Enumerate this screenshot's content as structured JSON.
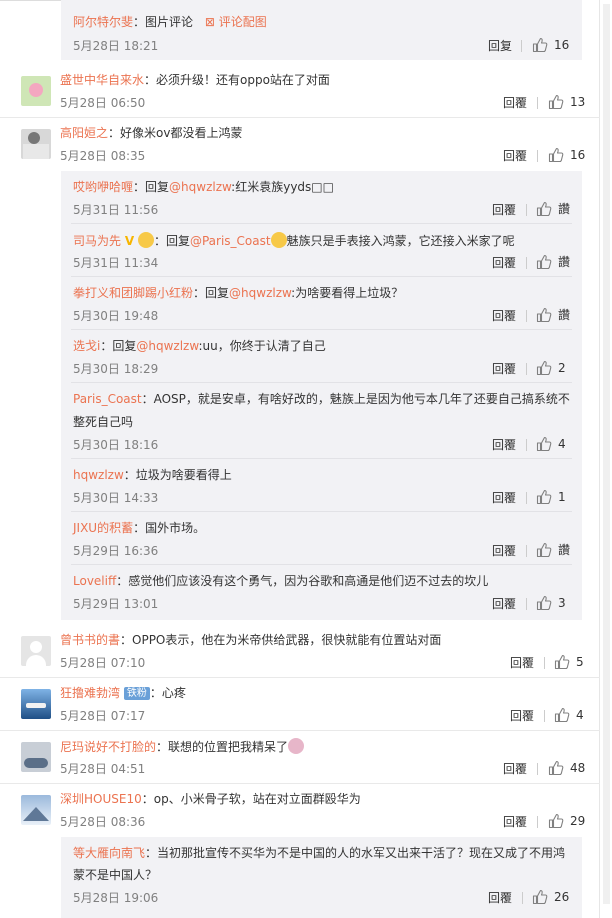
{
  "ui": {
    "reply_label": "回复",
    "reply_label_alt": "回覆",
    "sub_reply_label": "回覆"
  },
  "top": {
    "user": "阿尔特尔斐",
    "text": "：图片评论",
    "pic_link": "评论配图",
    "time": "5月28日 18:21",
    "likes": "16"
  },
  "comments": [
    {
      "user": "盛世中华自来水",
      "text": "：必须升级！还有oppo站在了对面",
      "time": "5月28日 06:50",
      "reply": "回覆",
      "likes": "13"
    },
    {
      "user": "高阳姮之",
      "text": "：好像米ov都没看上鸿蒙",
      "time": "5月28日 08:35",
      "reply": "回覆",
      "likes": "16"
    }
  ],
  "replies": [
    {
      "user": "哎哟咿哈喱",
      "pre": "：回复",
      "at": "@hqwzlzw",
      "text": ":红米袁族yyds□□",
      "time": "5月31日 11:56",
      "reply": "回覆",
      "likes": "讚"
    },
    {
      "user": "司马为先",
      "pre": "：回复",
      "at": "@Paris_Coast",
      "text": "魅族只是手表接入鸿蒙，它还接入米家了呢",
      "time": "5月31日 11:34",
      "reply": "回覆",
      "likes": "讚"
    },
    {
      "user": "拳打义和团脚踢小红粉",
      "pre": "：回复",
      "at": "@hqwzlzw",
      "text": ":为啥要看得上垃圾？",
      "time": "5月30日 19:48",
      "reply": "回覆",
      "likes": "讚"
    },
    {
      "user": "选戈i",
      "pre": "：回复",
      "at": "@hqwzlzw",
      "text": ":uu，你终于认清了自己",
      "time": "5月30日 18:29",
      "reply": "回覆",
      "likes": "2"
    },
    {
      "user": "Paris_Coast",
      "pre": "",
      "at": "",
      "text": "：AOSP，就是安卓，有啥好改的，魅族上是因为他亏本几年了还要自己搞系统不",
      "text2": "整死自己吗",
      "time": "5月30日 18:16",
      "reply": "回覆",
      "likes": "4"
    },
    {
      "user": "hqwzlzw",
      "pre": "",
      "at": "",
      "text": "：垃圾为啥要看得上",
      "time": "5月30日 14:33",
      "reply": "回覆",
      "likes": "1"
    },
    {
      "user": "JIXU的积蓄",
      "pre": "",
      "at": "",
      "text": "：国外市场。",
      "time": "5月29日 16:36",
      "reply": "回覆",
      "likes": "讚"
    },
    {
      "user": "Loveliff",
      "pre": "",
      "at": "",
      "text": "：感觉他们应该没有这个勇气，因为谷歌和高通是他们迈不过去的坎儿",
      "time": "5月29日 13:01",
      "reply": "回覆",
      "likes": "3"
    }
  ],
  "comments2": [
    {
      "user": "曾书书的書",
      "text": "：OPPO表示，他在为米帝供给武器，很快就能有位置站对面",
      "time": "5月28日 07:10",
      "reply": "回覆",
      "likes": "5"
    },
    {
      "user": "狂撸难勃湾",
      "badge": "铁粉",
      "text": "：心疼",
      "time": "5月28日 07:17",
      "reply": "回覆",
      "likes": "4"
    },
    {
      "user": "尼玛说好不打脸的",
      "text": "：联想的位置把我精呆了",
      "time": "5月28日 04:51",
      "reply": "回覆",
      "likes": "48"
    },
    {
      "user": "深圳HOUSE10",
      "text": "：op、小米骨子软，站在对立面群殴华为",
      "time": "5月28日 08:36",
      "reply": "回覆",
      "likes": "29"
    }
  ],
  "last_reply": {
    "user": "等大雁向南飞",
    "text": "：当初那批宣传不买华为不是中国的人的水军又出来干活了？现在又成了不用鸿",
    "text2": "蒙不是中国人？",
    "time": "5月28日 19:06",
    "reply": "回覆",
    "likes": "26"
  }
}
